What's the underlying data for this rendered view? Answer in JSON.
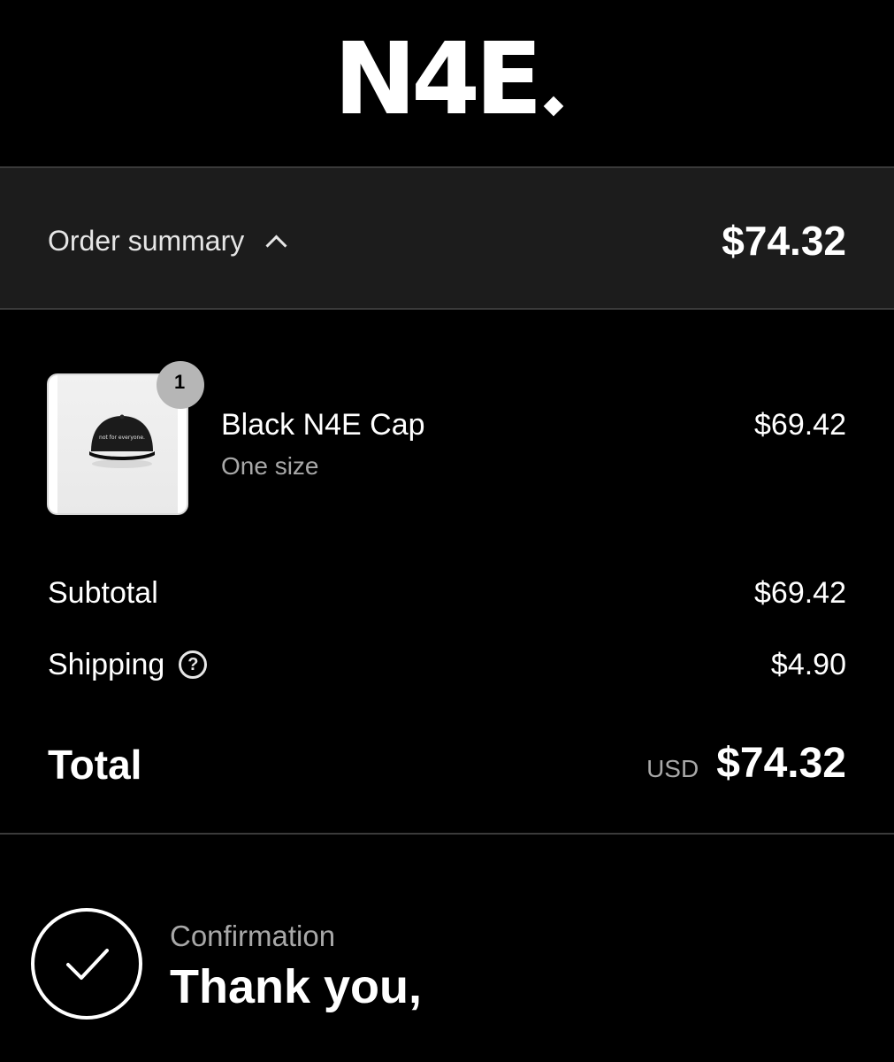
{
  "brand": {
    "logo_text": "N4E",
    "logo_dot": "."
  },
  "summary": {
    "toggle_label": "Order summary",
    "total": "$74.32"
  },
  "line_items": [
    {
      "quantity": "1",
      "name": "Black N4E Cap",
      "variant": "One size",
      "price": "$69.42",
      "image_text": "not for everyone."
    }
  ],
  "costs": {
    "subtotal_label": "Subtotal",
    "subtotal_value": "$69.42",
    "shipping_label": "Shipping",
    "shipping_value": "$4.90",
    "total_label": "Total",
    "currency": "USD",
    "total_value": "$74.32"
  },
  "confirmation": {
    "label": "Confirmation",
    "heading": "Thank you,"
  },
  "icons": {
    "summary_toggle": "chevron-up-icon",
    "shipping_help": "question-circle-icon",
    "confirmation": "checkmark-icon"
  },
  "colors": {
    "background": "#000000",
    "summary_bar": "#1c1c1c",
    "muted_text": "#a8a8a8",
    "badge": "#b6b6b6"
  }
}
